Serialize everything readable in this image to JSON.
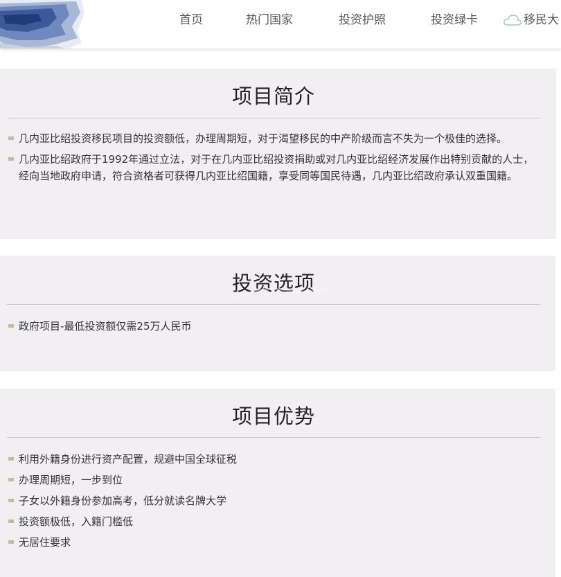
{
  "header": {
    "nav": [
      {
        "label": "首页"
      },
      {
        "label": "热门国家"
      },
      {
        "label": "投资护照"
      },
      {
        "label": "投资绿卡"
      },
      {
        "label": "移民大"
      }
    ]
  },
  "sections": [
    {
      "title": "项目简介",
      "items": [
        "几内亚比绍投资移民项目的投资额低，办理周期短，对于渴望移民的中产阶级而言不失为一个极佳的选择。",
        "几内亚比绍政府于1992年通过立法，对于在几内亚比绍投资捐助或对几内亚比绍经济发展作出特别贡献的人士，经向当地政府申请，符合资格者可获得几内亚比绍国籍，享受同等国民待遇，几内亚比绍政府承认双重国籍。"
      ]
    },
    {
      "title": "投资选项",
      "items": [
        "政府项目-最低投资额仅需25万人民币"
      ]
    },
    {
      "title": "项目优势",
      "items": [
        "利用外籍身份进行资产配置，规避中国全球征税",
        "办理周期短，一步到位",
        "子女以外籍身份参加高考，低分就读名牌大学",
        "投资额极低，入籍门槛低",
        "无居住要求"
      ]
    }
  ],
  "colors": {
    "section_bg": "#f1eff1",
    "bullet": "#c4bb9c",
    "rule": "#c9c6c6",
    "logo_blue": "#3c5a9a"
  },
  "icons": {
    "nav_cloud": "cloud-icon",
    "logo": "logo-art"
  }
}
